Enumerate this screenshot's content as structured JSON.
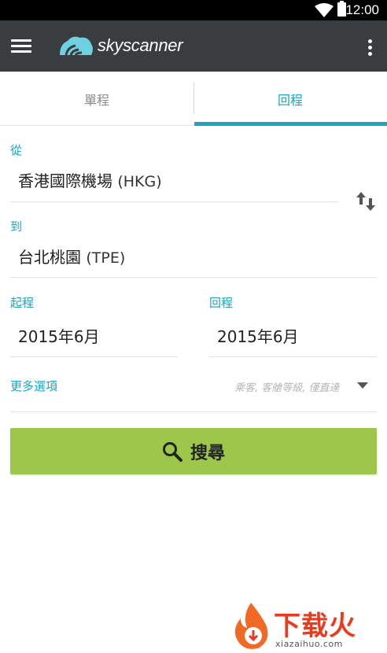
{
  "status_bar": {
    "time": "12:00"
  },
  "app_bar": {
    "logo_text": "skyscanner"
  },
  "tabs": [
    {
      "label": "單程",
      "selected": false
    },
    {
      "label": "回程",
      "selected": true
    }
  ],
  "from": {
    "label": "從",
    "city": "香港國際機場",
    "code": "(HKG)"
  },
  "to": {
    "label": "到",
    "city": "台北桃園",
    "code": "(TPE)"
  },
  "depart": {
    "label": "起程",
    "value": "2015年6月"
  },
  "return": {
    "label": "回程",
    "value": "2015年6月"
  },
  "more_options": {
    "label": "更多選項",
    "hint": "乘客, 客艙等級, 僅直達"
  },
  "search_button": {
    "label": "搜尋"
  },
  "watermark": {
    "title": "下载火",
    "url": "xiazaihuo.com"
  },
  "colors": {
    "accent": "#1ea3c0",
    "app_bar": "#3a3d40",
    "search_button": "#9dc74a",
    "watermark": "#e83c1f"
  },
  "icons": [
    "menu-icon",
    "skyscanner-logo-icon",
    "overflow-menu-icon",
    "swap-icon",
    "dropdown-arrow-icon",
    "search-icon"
  ]
}
